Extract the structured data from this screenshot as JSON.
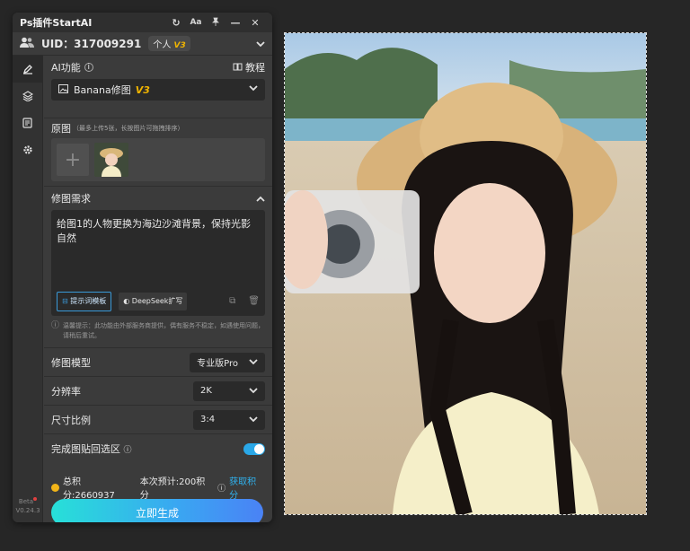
{
  "app": {
    "title": "Ps插件StartAI"
  },
  "titlebar": {
    "refresh_icon": "↻",
    "font_icon": "Aa",
    "pin_icon": "⊥",
    "minimize_icon": "—",
    "close_icon": "✕"
  },
  "user": {
    "uid": "UID：317009291",
    "plan": "个人",
    "plan_version": "V3"
  },
  "ai": {
    "label": "AI功能",
    "tutorial": "教程",
    "model_select": "Banana修图",
    "model_version": "V3"
  },
  "source": {
    "label": "原图",
    "hint": "（最多上传5张，长按图片可拖拽排序）"
  },
  "request": {
    "label": "修图需求",
    "text": "给图1的人物更换为海边沙滩背景，保持光影自然",
    "template_button": "提示词模板",
    "deepseek_button": "DeepSeek扩写"
  },
  "notice": "温馨提示：此功能由外部服务商提供，偶有服务不稳定，如遇使用问题，请稍后重试。",
  "options": {
    "model_label": "修图模型",
    "model_value": "专业版Pro",
    "resolution_label": "分辨率",
    "resolution_value": "2K",
    "ratio_label": "尺寸比例",
    "ratio_value": "3:4",
    "paste_label": "完成图贴回选区",
    "paste_enabled": true
  },
  "points": {
    "total": "总积分:2660937",
    "estimate": "本次预计:200积分",
    "get": "获取积分"
  },
  "generate": {
    "label": "立即生成"
  },
  "version": {
    "beta": "Beta",
    "number": "V0.24.3"
  },
  "colors": {
    "accent": "#2fb3f0",
    "gold": "#f0b400"
  }
}
